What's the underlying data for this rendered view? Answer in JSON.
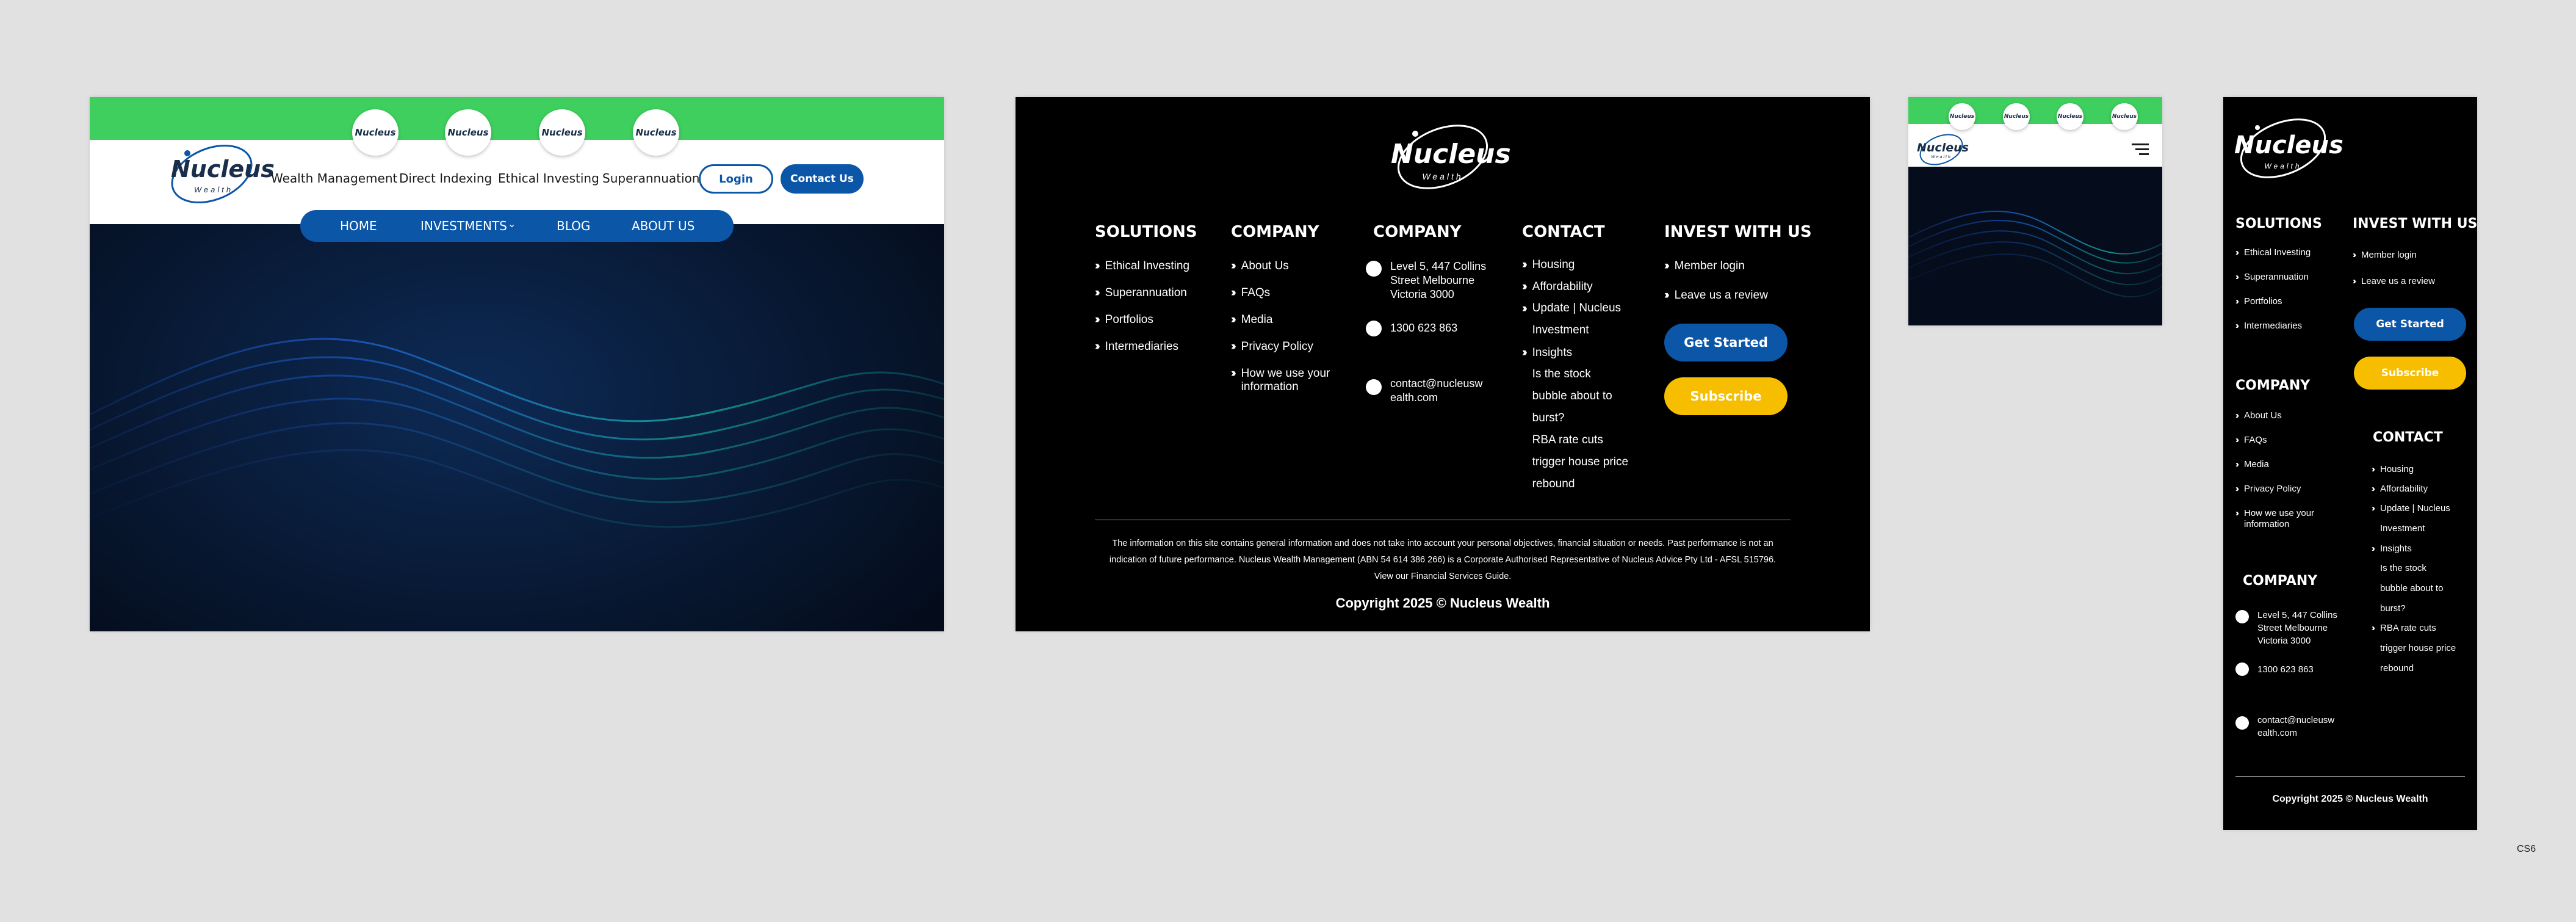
{
  "colors": {
    "green": "#3fcf5e",
    "blue": "#0c56a8",
    "yellow": "#f7be00",
    "black": "#000000",
    "navy": "#061226",
    "page_bg": "#e1e1e1"
  },
  "brand": {
    "name": "Nucleus",
    "tagline": "Wealth"
  },
  "desktop": {
    "badges": [
      "Nucleus",
      "Nucleus",
      "Nucleus",
      "Nucleus"
    ],
    "nav": [
      "Wealth Management",
      "Direct Indexing",
      "Ethical Investing",
      "Superannuation"
    ],
    "login": "Login",
    "contact": "Contact Us",
    "subnav": [
      "HOME",
      "INVESTMENTS",
      "BLOG",
      "ABOUT US"
    ]
  },
  "footer": {
    "solutions": {
      "heading": "SOLUTIONS",
      "items": [
        "Ethical Investing",
        "Superannuation",
        "Portfolios",
        "Intermediaries"
      ]
    },
    "company": {
      "heading": "COMPANY",
      "items": [
        "About Us",
        "FAQs",
        "Media",
        "Privacy Policy",
        "How we use your\ninformation"
      ]
    },
    "company2": {
      "heading": "COMPANY",
      "address": "Level 5, 447 Collins\nStreet Melbourne\nVictoria 3000",
      "phone": "1300 623 863",
      "email": "contact@nucleusw\nealth.com"
    },
    "contact": {
      "heading": "CONTACT",
      "items": [
        "Housing",
        "Affordability",
        "Update | Nucleus\nInvestment",
        "Insights",
        "Is the stock\nbubble about to\nburst?",
        "RBA rate cuts\ntrigger house price\nrebound"
      ]
    },
    "invest": {
      "heading": "INVEST WITH US",
      "items": [
        "Member login",
        "Leave us a review"
      ],
      "get_started": "Get Started",
      "subscribe": "Subscribe"
    },
    "disclaimer": "The information on this site contains general information and does not take into account your personal objectives, financial situation or needs. Past performance is not an indication of future performance. Nucleus Wealth Management (ABN 54 614 386 266) is a Corporate Authorised Representative of Nucleus Advice Pty Ltd - AFSL 515796. View our Financial Services Guide.",
    "copyright": "Copyright 2025 © Nucleus Wealth"
  },
  "mobile": {
    "badges": [
      "Nucleus",
      "Nucleus",
      "Nucleus",
      "Nucleus"
    ]
  },
  "corner_label": "CS6"
}
